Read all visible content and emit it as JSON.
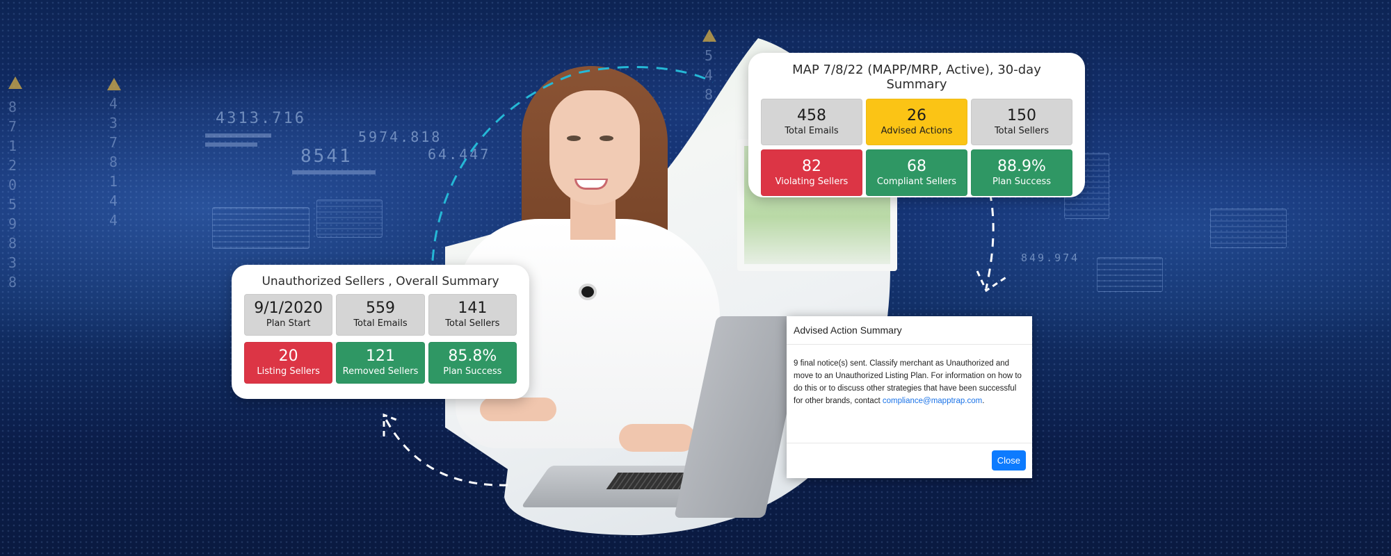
{
  "background": {
    "decorative_numbers": [
      "4313.716",
      "5974.818",
      "8541",
      "64.447",
      "849.974"
    ],
    "decorative_column_left": [
      "8",
      "7",
      "1",
      "2",
      "0",
      "5",
      "9",
      "8",
      "3",
      "8"
    ],
    "decorative_column_mid": [
      "4",
      "3",
      "7",
      "8",
      "1",
      "4",
      "4"
    ],
    "decorative_column_top": [
      "5",
      "4",
      "8"
    ]
  },
  "map_summary": {
    "title": "MAP 7/8/22 (MAPP/MRP, Active), 30-day Summary",
    "tiles": [
      {
        "value": "458",
        "label": "Total Emails",
        "color": "#d5d5d5"
      },
      {
        "value": "26",
        "label": "Advised Actions",
        "color": "#fbc415"
      },
      {
        "value": "150",
        "label": "Total Sellers",
        "color": "#d5d5d5"
      },
      {
        "value": "82",
        "label": "Violating Sellers",
        "color": "#dc3545"
      },
      {
        "value": "68",
        "label": "Compliant Sellers",
        "color": "#2f9764"
      },
      {
        "value": "88.9%",
        "label": "Plan Success",
        "color": "#2f9764"
      }
    ]
  },
  "unauthorized_summary": {
    "title": "Unauthorized Sellers , Overall Summary",
    "tiles": [
      {
        "value": "9/1/2020",
        "label": "Plan Start",
        "color": "#d5d5d5"
      },
      {
        "value": "559",
        "label": "Total Emails",
        "color": "#d5d5d5"
      },
      {
        "value": "141",
        "label": "Total Sellers",
        "color": "#d5d5d5"
      },
      {
        "value": "20",
        "label": "Listing Sellers",
        "color": "#dc3545"
      },
      {
        "value": "121",
        "label": "Removed Sellers",
        "color": "#2f9764"
      },
      {
        "value": "85.8%",
        "label": "Plan Success",
        "color": "#2f9764"
      }
    ]
  },
  "advised_action_modal": {
    "title": "Advised Action Summary",
    "body_text": "9 final notice(s) sent. Classify merchant as Unauthorized and move to an Unauthorized Listing Plan. For information on how to do this or to discuss other strategies that have been successful for other brands, contact ",
    "contact_email": "compliance@mapptrap.com",
    "body_suffix": ".",
    "close_label": "Close",
    "accent_color": "#0d7bfe"
  }
}
